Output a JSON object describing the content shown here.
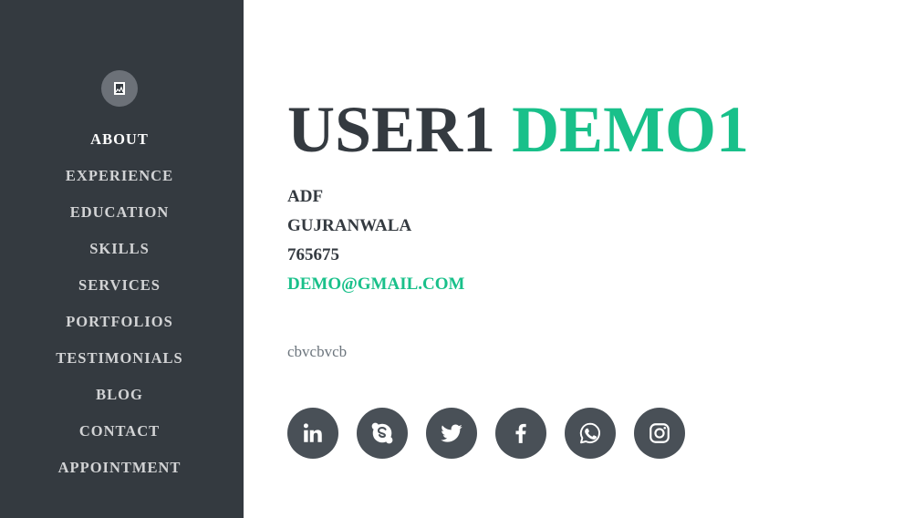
{
  "sidebar": {
    "nav": [
      {
        "label": "ABOUT",
        "active": true
      },
      {
        "label": "EXPERIENCE"
      },
      {
        "label": "EDUCATION"
      },
      {
        "label": "SKILLS"
      },
      {
        "label": "SERVICES"
      },
      {
        "label": "PORTFOLIOS"
      },
      {
        "label": "TESTIMONIALS"
      },
      {
        "label": "BLOG"
      },
      {
        "label": "CONTACT"
      },
      {
        "label": "APPOINTMENT"
      }
    ]
  },
  "profile": {
    "first_name": "USER1",
    "last_name": "DEMO1",
    "address": "ADF",
    "city": "GUJRANWALA",
    "phone": "765675",
    "email": "DEMO@GMAIL.COM",
    "bio": "cbvcbvcb"
  },
  "social": [
    "linkedin-icon",
    "skype-icon",
    "twitter-icon",
    "facebook-icon",
    "whatsapp-icon",
    "instagram-icon"
  ],
  "colors": {
    "sidebar_bg": "#343a40",
    "accent": "#19c08a",
    "text_dark": "#343a40",
    "social_bg": "#495057"
  }
}
